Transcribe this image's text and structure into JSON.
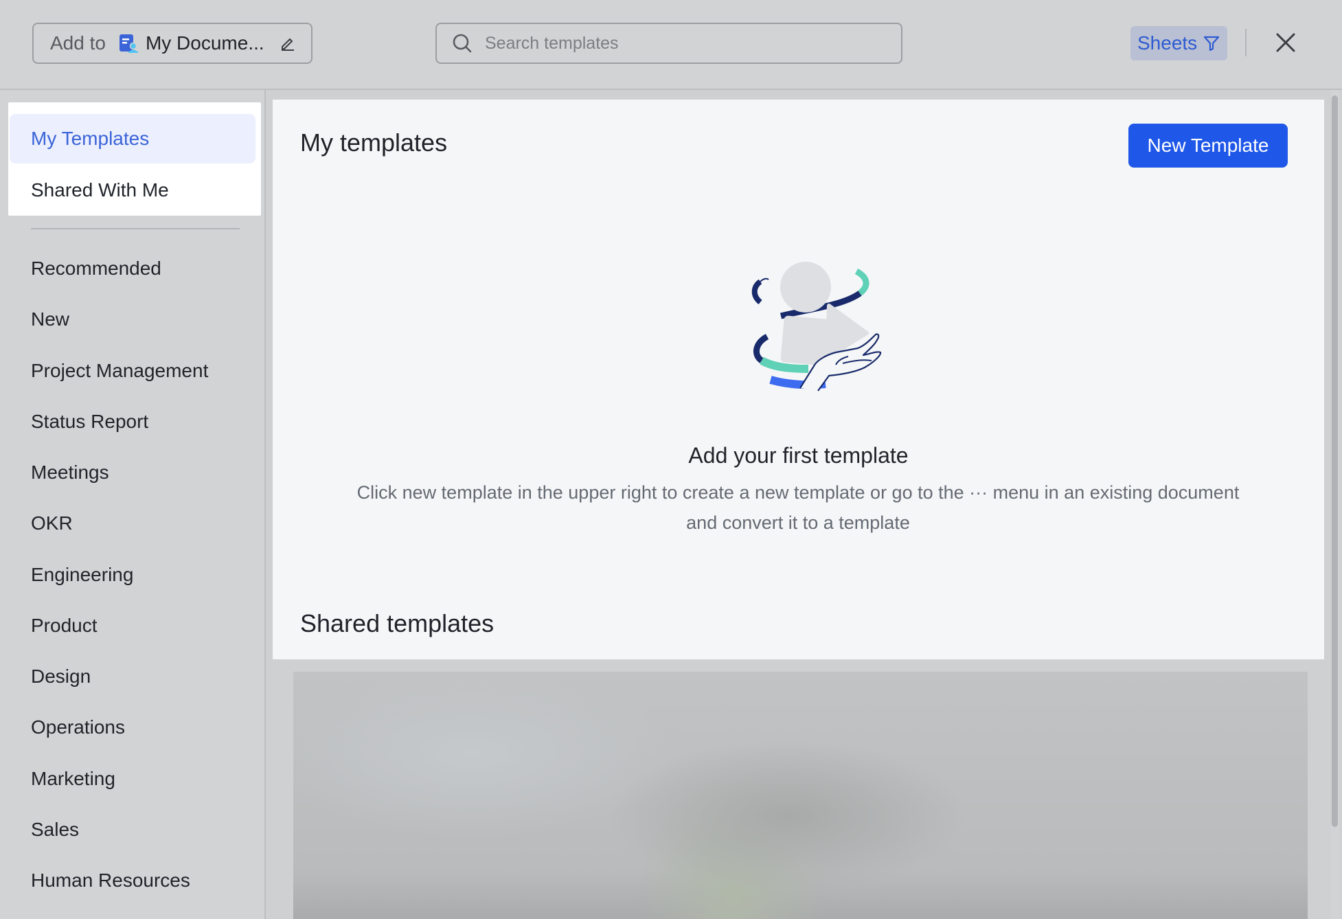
{
  "header": {
    "add_to_label": "Add to",
    "document_name": "My Docume...",
    "search_placeholder": "Search templates",
    "filter_label": "Sheets"
  },
  "sidebar": {
    "top_items": [
      "My Templates",
      "Shared With Me"
    ],
    "categories": [
      "Recommended",
      "New",
      "Project Management",
      "Status Report",
      "Meetings",
      "OKR",
      "Engineering",
      "Product",
      "Design",
      "Operations",
      "Marketing",
      "Sales",
      "Human Resources"
    ]
  },
  "main": {
    "title": "My templates",
    "new_template_button": "New Template",
    "empty_title": "Add your first template",
    "empty_description": "Click new template in the upper right to create a new template or go to the ··· menu in an existing document and convert it to a template",
    "shared_title": "Shared templates"
  },
  "colors": {
    "accent": "#1f57e8",
    "active_nav_text": "#3a64d8",
    "active_nav_bg": "#eceffd",
    "overlay_bg": "#d2d3d4"
  }
}
